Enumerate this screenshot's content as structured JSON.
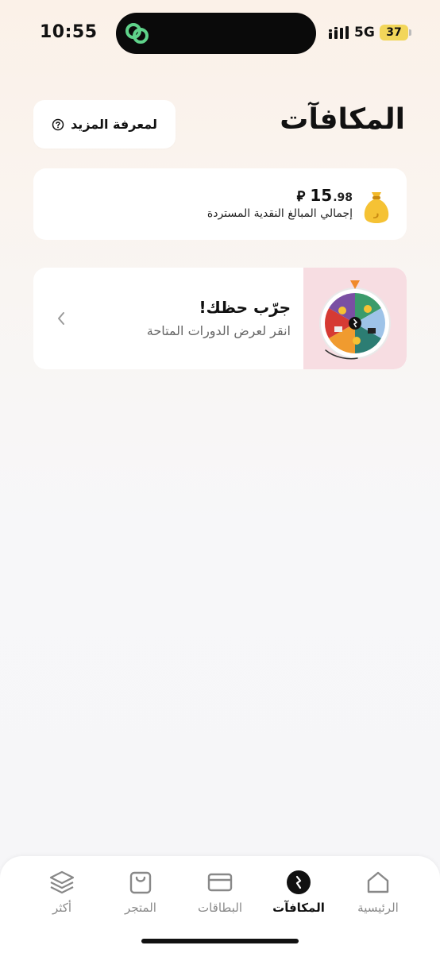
{
  "status_bar": {
    "time": "10:55",
    "network": "5G",
    "battery": "37"
  },
  "header": {
    "title": "المكافآت",
    "learn_more_label": "لمعرفة المزيد"
  },
  "cashback": {
    "currency_symbol": "⃁",
    "amount_integer": "15",
    "amount_decimal": ".98",
    "label": "إجمالي المبالغ النقدية المستردة"
  },
  "spin_wheel": {
    "title": "جرّب حظك!",
    "subtitle": "انقر لعرض الدورات المتاحة"
  },
  "tab_bar": {
    "tabs": [
      {
        "label": "الرئيسية",
        "icon": "home-icon"
      },
      {
        "label": "المكافآت",
        "icon": "rewards-icon"
      },
      {
        "label": "البطاقات",
        "icon": "card-icon"
      },
      {
        "label": "المتجر",
        "icon": "shopping-bag-icon"
      },
      {
        "label": "أكثر",
        "icon": "layers-icon"
      }
    ],
    "active": "المكافآت"
  },
  "colors": {
    "accent": "#111111",
    "card_bg": "#ffffff",
    "wheel_bg": "#f7dde2",
    "battery": "#f2d65a",
    "app_icon": "#5fd38a"
  }
}
